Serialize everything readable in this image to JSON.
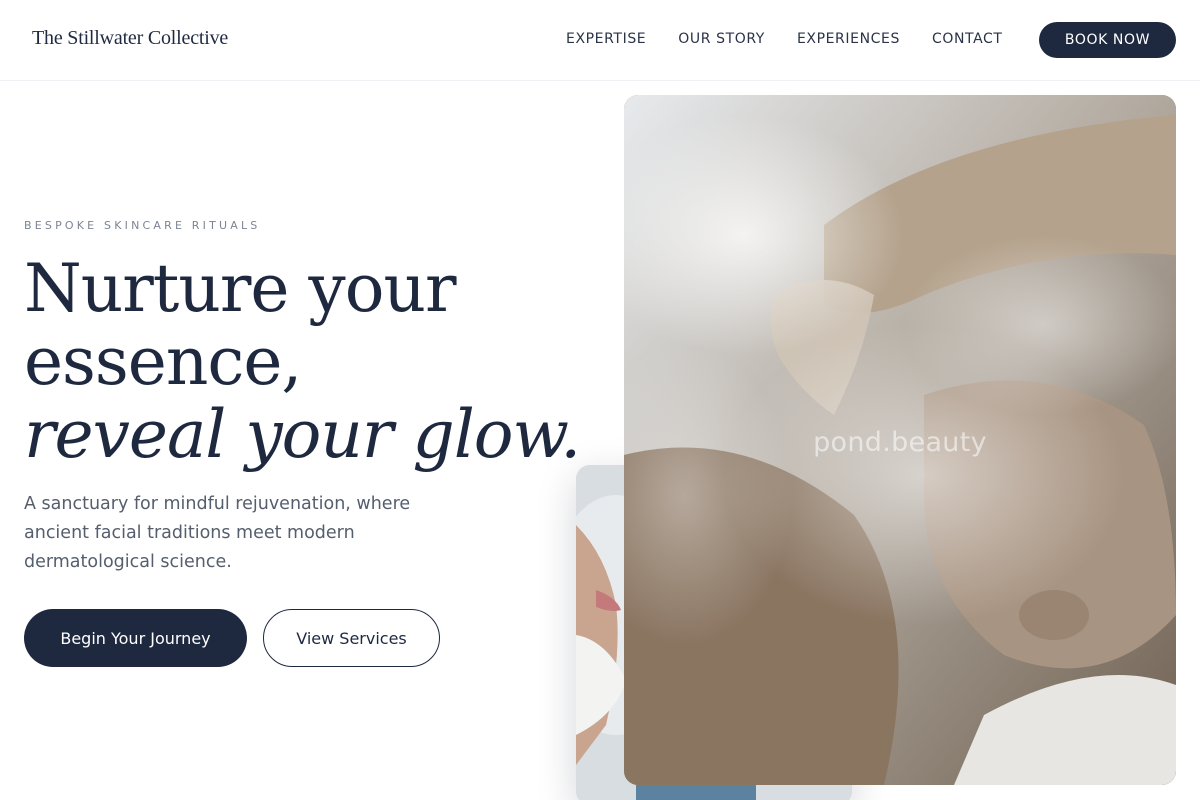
{
  "header": {
    "brand": "The Stillwater Collective",
    "nav": [
      "EXPERTISE",
      "OUR STORY",
      "EXPERIENCES",
      "CONTACT"
    ],
    "book_label": "BOOK NOW"
  },
  "hero": {
    "eyebrow": "BESPOKE SKINCARE RITUALS",
    "headline_line1": "Nurture your",
    "headline_line2": "essence,",
    "headline_line3": "reveal your glow.",
    "description": "A sanctuary for mindful rejuvenation, where ancient facial traditions meet modern dermatological science.",
    "primary_cta": "Begin Your Journey",
    "secondary_cta": "View Services"
  },
  "images": {
    "main_watermark": "pond.beauty"
  },
  "colors": {
    "accent": "#1e2940",
    "text_muted": "#555e6d",
    "eyebrow": "#7b8595"
  }
}
